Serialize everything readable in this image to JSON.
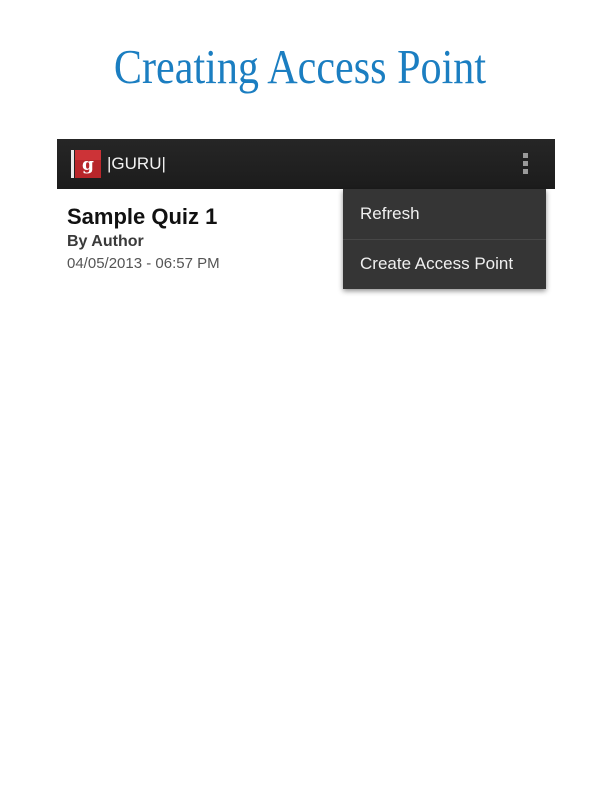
{
  "page": {
    "heading": "Creating Access Point"
  },
  "action_bar": {
    "app_icon": "guru-logo-icon",
    "app_title": "|GURU|",
    "overflow_icon": "overflow-menu-icon"
  },
  "quiz": {
    "title": "Sample Quiz 1",
    "author": "By Author",
    "date": "04/05/2013 - 06:57 PM"
  },
  "overflow_menu": {
    "items": [
      {
        "label": "Refresh"
      },
      {
        "label": "Create Access Point"
      }
    ]
  },
  "colors": {
    "heading": "#1b7ec1",
    "action_bar": "#1f1f1f",
    "menu_bg": "#353535",
    "logo_red": "#b8262a"
  }
}
